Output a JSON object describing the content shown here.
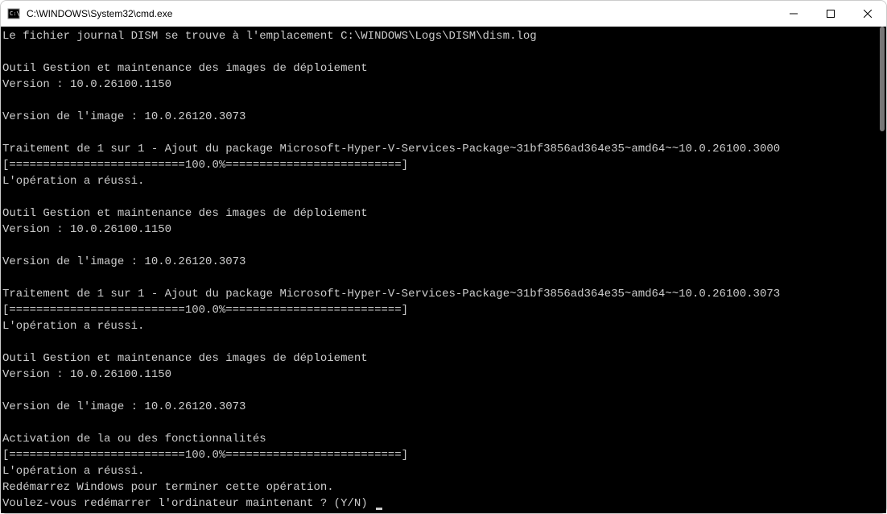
{
  "titlebar": {
    "title": "C:\\WINDOWS\\System32\\cmd.exe"
  },
  "terminal": {
    "lines": [
      "Le fichier journal DISM se trouve à l'emplacement C:\\WINDOWS\\Logs\\DISM\\dism.log",
      "",
      "Outil Gestion et maintenance des images de déploiement",
      "Version : 10.0.26100.1150",
      "",
      "Version de l'image : 10.0.26120.3073",
      "",
      "Traitement de 1 sur 1 - Ajout du package Microsoft-Hyper-V-Services-Package~31bf3856ad364e35~amd64~~10.0.26100.3000",
      "[==========================100.0%==========================]",
      "L'opération a réussi.",
      "",
      "Outil Gestion et maintenance des images de déploiement",
      "Version : 10.0.26100.1150",
      "",
      "Version de l'image : 10.0.26120.3073",
      "",
      "Traitement de 1 sur 1 - Ajout du package Microsoft-Hyper-V-Services-Package~31bf3856ad364e35~amd64~~10.0.26100.3073",
      "[==========================100.0%==========================]",
      "L'opération a réussi.",
      "",
      "Outil Gestion et maintenance des images de déploiement",
      "Version : 10.0.26100.1150",
      "",
      "Version de l'image : 10.0.26120.3073",
      "",
      "Activation de la ou des fonctionnalités",
      "[==========================100.0%==========================]",
      "L'opération a réussi.",
      "Redémarrez Windows pour terminer cette opération."
    ],
    "prompt_line": "Voulez-vous redémarrer l'ordinateur maintenant ? (Y/N) "
  }
}
